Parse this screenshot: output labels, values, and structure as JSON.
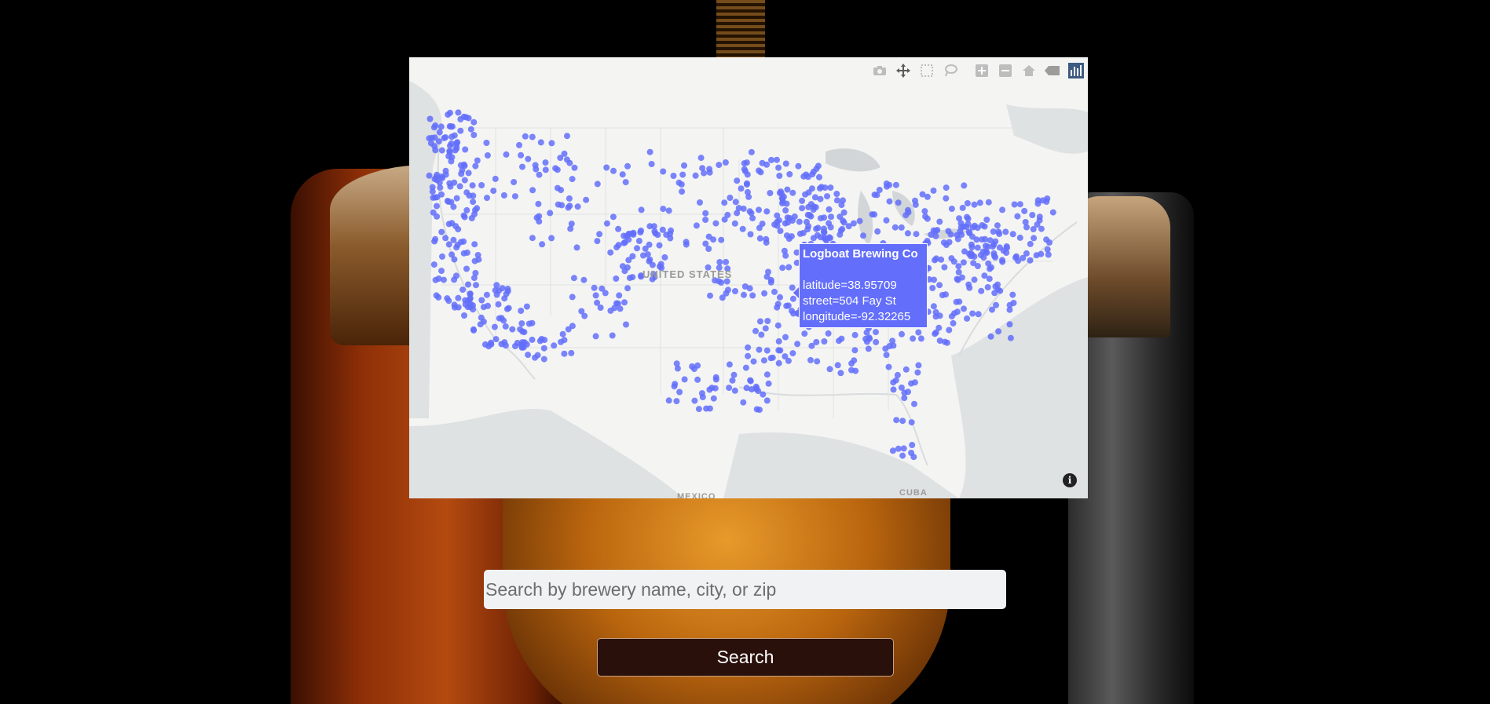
{
  "map": {
    "country_label": "UNITED STATES",
    "bottom_labels": [
      "MEXICO",
      "CUBA"
    ],
    "marker_color": "#636efa",
    "modebar_icons": [
      "camera-icon",
      "pan-icon",
      "box-select-icon",
      "lasso-icon",
      "zoom-in-icon",
      "zoom-out-icon",
      "home-icon",
      "hover-compare-icon",
      "plotly-logo-icon"
    ],
    "info_label": "i"
  },
  "tooltip": {
    "name": "Logboat Brewing Co",
    "latitude": "latitude=38.95709",
    "street": "street=504 Fay St",
    "longitude": "longitude=-92.32265"
  },
  "search": {
    "placeholder": "Search by brewery name, city, or zip",
    "button_label": "Search"
  }
}
